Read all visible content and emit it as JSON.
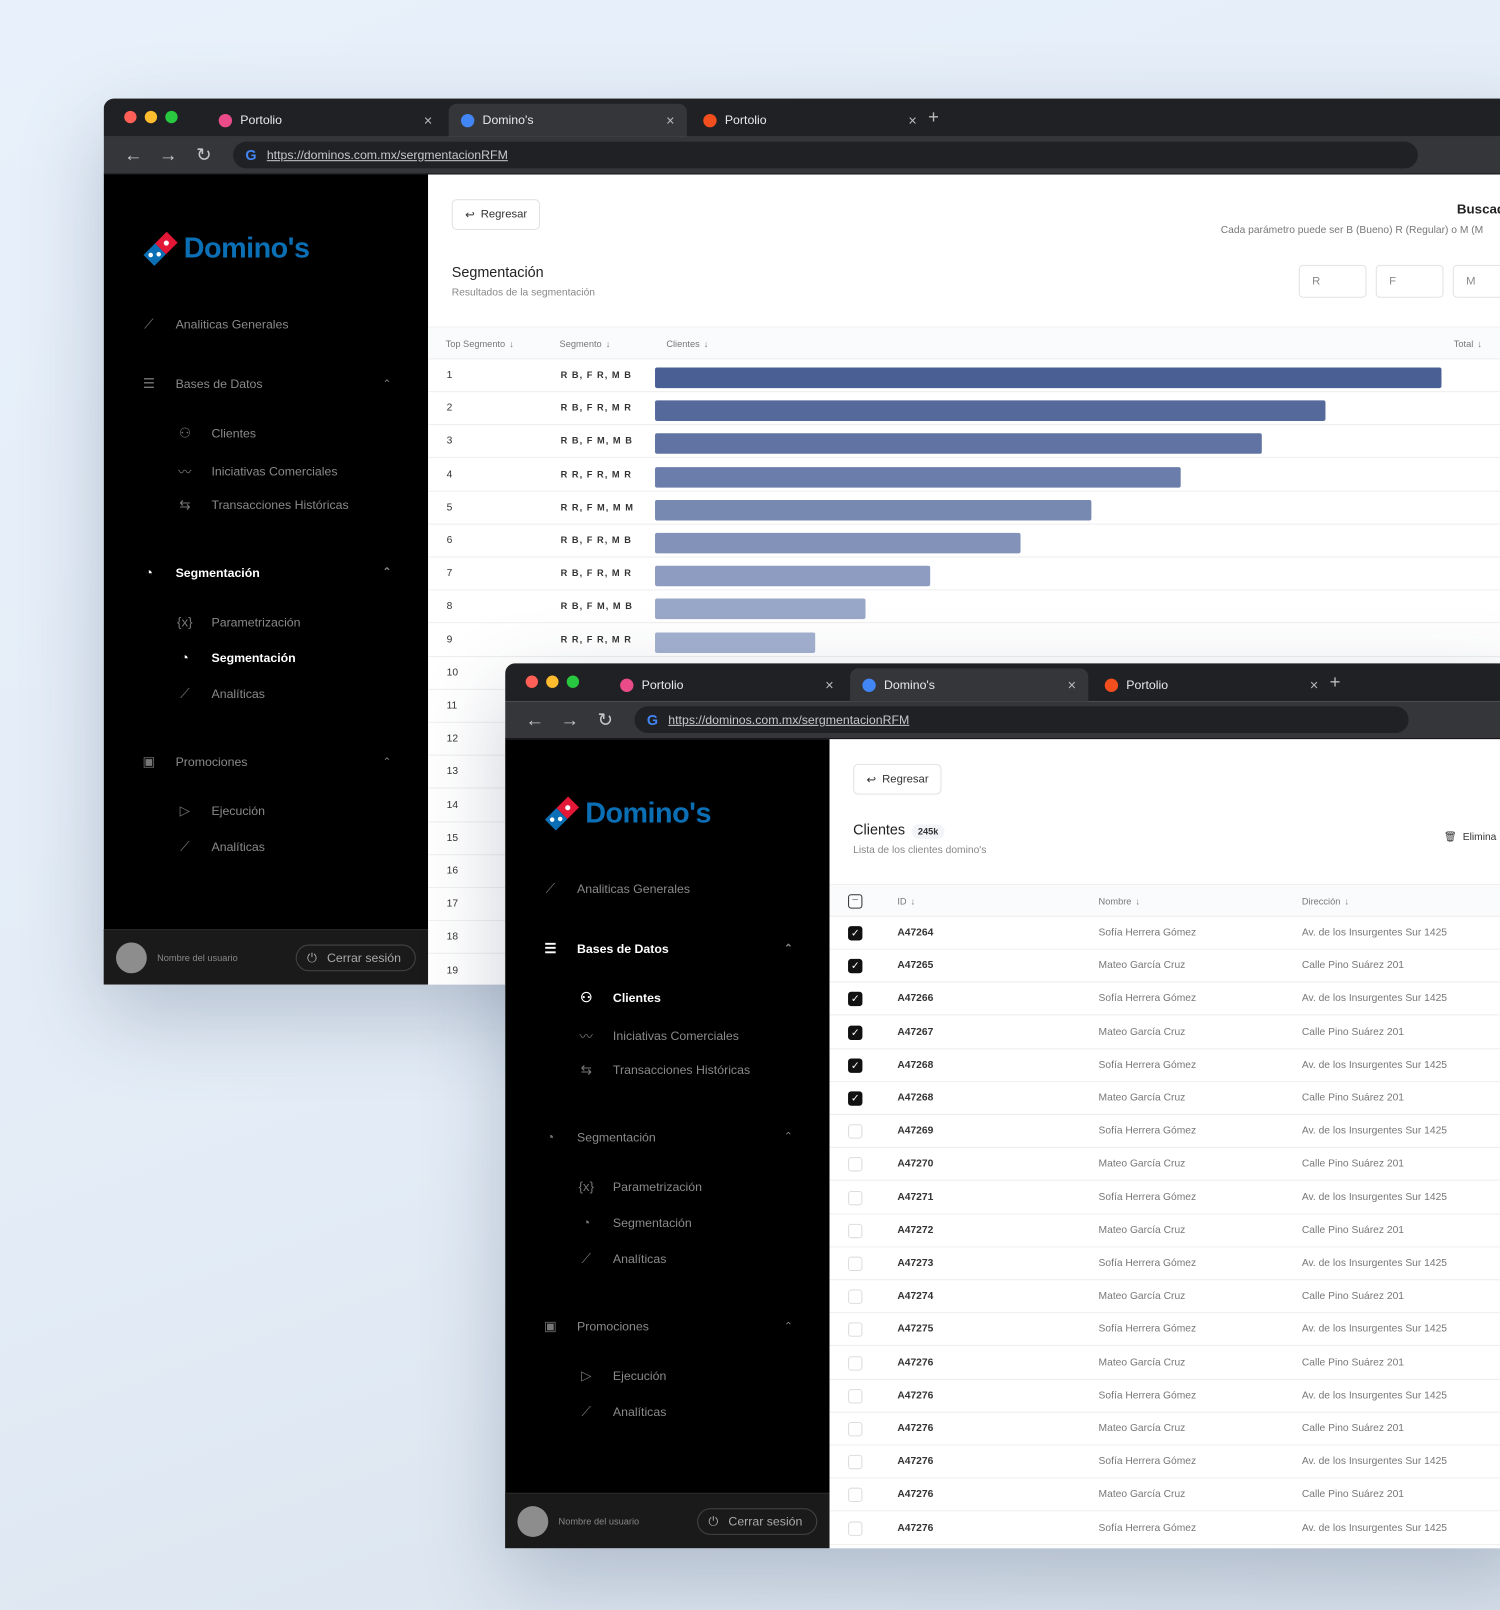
{
  "browser": {
    "tabs": [
      {
        "label": "Portolio",
        "favicon": "dribbble-icon"
      },
      {
        "label": "Domino's",
        "favicon": "google-icon"
      },
      {
        "label": "Portolio",
        "favicon": "figma-icon"
      }
    ],
    "url": "https://dominos.com.mx/sergmentacionRFM"
  },
  "brand": {
    "name": "Domino's",
    "blue": "#0b6fb5",
    "red": "#e31837"
  },
  "sidebar": {
    "items": [
      {
        "label": "Analiticas Generales",
        "icon": "line-chart-icon",
        "level": 0
      },
      {
        "label": "Bases de Datos",
        "icon": "database-icon",
        "level": 0,
        "chevron": true
      },
      {
        "label": "Clientes",
        "icon": "users-icon",
        "level": 1
      },
      {
        "label": "Iniciativas Comerciales",
        "icon": "trend-icon",
        "level": 1
      },
      {
        "label": "Transacciones Históricas",
        "icon": "swap-icon",
        "level": 1
      },
      {
        "label": "Segmentación",
        "icon": "pie-icon",
        "level": 0,
        "chevron": true
      },
      {
        "label": "Parametrización",
        "icon": "variable-icon",
        "level": 1
      },
      {
        "label": "Segmentación",
        "icon": "pie-icon",
        "level": 1
      },
      {
        "label": "Analíticas",
        "icon": "line-chart-icon",
        "level": 1
      },
      {
        "label": "Promociones",
        "icon": "ticket-icon",
        "level": 0,
        "chevron": true
      },
      {
        "label": "Ejecución",
        "icon": "play-icon",
        "level": 1
      },
      {
        "label": "Analíticas",
        "icon": "line-chart-icon",
        "level": 1
      }
    ],
    "user": "Nombre del usuario",
    "logout": "Cerrar sesión"
  },
  "window1": {
    "active_items": [
      5,
      7
    ],
    "back": "Regresar",
    "title": "Segmentación",
    "subtitle": "Resultados de la segmentación",
    "search_title": "Buscad",
    "search_hint": "Cada parámetro puede ser B (Bueno) R (Regular) o M (M",
    "rfm_placeholders": [
      "R",
      "F",
      "M"
    ],
    "columns": [
      "Top Segmento",
      "Segmento",
      "Clientes",
      "Total"
    ],
    "rows": [
      {
        "rank": "1",
        "segment": "R B, F R, M B",
        "clientes_share": 1.0
      },
      {
        "rank": "2",
        "segment": "R B, F R, M R",
        "clientes_share": 0.852
      },
      {
        "rank": "3",
        "segment": "R B, F M, M B",
        "clientes_share": 0.771
      },
      {
        "rank": "4",
        "segment": "R R, F R,  M R",
        "clientes_share": 0.668
      },
      {
        "rank": "5",
        "segment": "R R, F M, M M",
        "clientes_share": 0.555
      },
      {
        "rank": "6",
        "segment": "R B, F R, M B",
        "clientes_share": 0.465
      },
      {
        "rank": "7",
        "segment": "R B, F R, M R",
        "clientes_share": 0.35
      },
      {
        "rank": "8",
        "segment": "R B, F M, M B",
        "clientes_share": 0.268
      },
      {
        "rank": "9",
        "segment": "R R, F R,  M R",
        "clientes_share": 0.204
      },
      {
        "rank": "10"
      },
      {
        "rank": "11"
      },
      {
        "rank": "12"
      },
      {
        "rank": "13"
      },
      {
        "rank": "14"
      },
      {
        "rank": "15"
      },
      {
        "rank": "16"
      },
      {
        "rank": "17"
      },
      {
        "rank": "18"
      },
      {
        "rank": "19"
      }
    ],
    "bar_colors": [
      "#4a5f93",
      "#a3b0cf"
    ]
  },
  "window2": {
    "active_items": [
      1,
      2
    ],
    "back": "Regresar",
    "title": "Clientes",
    "count_badge": "245k",
    "subtitle": "Lista de los clientes domino's",
    "delete": "Elimina",
    "columns": [
      "ID",
      "Nombre",
      "Dirección"
    ],
    "rows": [
      {
        "id": "A47264",
        "name": "Sofía Herrera Gómez",
        "address": "Av. de los Insurgentes Sur 1425",
        "checked": true
      },
      {
        "id": "A47265",
        "name": "Mateo García Cruz",
        "address": "Calle Pino Suárez 201",
        "checked": true
      },
      {
        "id": "A47266",
        "name": "Sofía Herrera Gómez",
        "address": "Av. de los Insurgentes Sur 1425",
        "checked": true
      },
      {
        "id": "A47267",
        "name": "Mateo García Cruz",
        "address": "Calle Pino Suárez 201",
        "checked": true
      },
      {
        "id": "A47268",
        "name": "Sofía Herrera Gómez",
        "address": "Av. de los Insurgentes Sur 1425",
        "checked": true
      },
      {
        "id": "A47268",
        "name": "Mateo García Cruz",
        "address": "Calle Pino Suárez 201",
        "checked": true
      },
      {
        "id": "A47269",
        "name": "Sofía Herrera Gómez",
        "address": "Av. de los Insurgentes Sur 1425",
        "checked": false
      },
      {
        "id": "A47270",
        "name": "Mateo García Cruz",
        "address": "Calle Pino Suárez 201",
        "checked": false
      },
      {
        "id": "A47271",
        "name": "Sofía Herrera Gómez",
        "address": "Av. de los Insurgentes Sur 1425",
        "checked": false
      },
      {
        "id": "A47272",
        "name": "Mateo García Cruz",
        "address": "Calle Pino Suárez 201",
        "checked": false
      },
      {
        "id": "A47273",
        "name": "Sofía Herrera Gómez",
        "address": "Av. de los Insurgentes Sur 1425",
        "checked": false
      },
      {
        "id": "A47274",
        "name": "Mateo García Cruz",
        "address": "Calle Pino Suárez 201",
        "checked": false
      },
      {
        "id": "A47275",
        "name": "Sofía Herrera Gómez",
        "address": "Av. de los Insurgentes Sur 1425",
        "checked": false
      },
      {
        "id": "A47276",
        "name": "Mateo García Cruz",
        "address": "Calle Pino Suárez 201",
        "checked": false
      },
      {
        "id": "A47276",
        "name": "Sofía Herrera Gómez",
        "address": "Av. de los Insurgentes Sur 1425",
        "checked": false
      },
      {
        "id": "A47276",
        "name": "Mateo García Cruz",
        "address": "Calle Pino Suárez 201",
        "checked": false
      },
      {
        "id": "A47276",
        "name": "Sofía Herrera Gómez",
        "address": "Av. de los Insurgentes Sur 1425",
        "checked": false
      },
      {
        "id": "A47276",
        "name": "Mateo García Cruz",
        "address": "Calle Pino Suárez 201",
        "checked": false
      },
      {
        "id": "A47276",
        "name": "Sofía Herrera Gómez",
        "address": "Av. de los Insurgentes Sur 1425",
        "checked": false
      }
    ]
  }
}
